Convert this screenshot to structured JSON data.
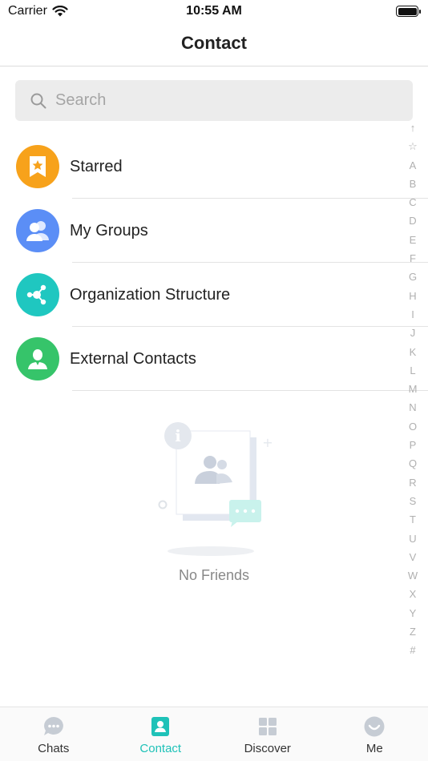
{
  "status_bar": {
    "carrier": "Carrier",
    "time": "10:55 AM"
  },
  "nav": {
    "title": "Contact"
  },
  "search": {
    "placeholder": "Search"
  },
  "list": [
    {
      "label": "Starred",
      "icon": "starred-icon",
      "color": "#f7a21b"
    },
    {
      "label": "My Groups",
      "icon": "groups-icon",
      "color": "#5b8ef6"
    },
    {
      "label": "Organization Structure",
      "icon": "organization-icon",
      "color": "#1fc7c0"
    },
    {
      "label": "External Contacts",
      "icon": "external-contacts-icon",
      "color": "#36c46a"
    }
  ],
  "empty_state": {
    "text": "No Friends"
  },
  "index_bar": [
    "↑",
    "☆",
    "A",
    "B",
    "C",
    "D",
    "E",
    "F",
    "G",
    "H",
    "I",
    "J",
    "K",
    "L",
    "M",
    "N",
    "O",
    "P",
    "Q",
    "R",
    "S",
    "T",
    "U",
    "V",
    "W",
    "X",
    "Y",
    "Z",
    "#"
  ],
  "tabs": [
    {
      "label": "Chats",
      "icon": "chats-icon",
      "active": false
    },
    {
      "label": "Contact",
      "icon": "contact-icon",
      "active": true
    },
    {
      "label": "Discover",
      "icon": "discover-icon",
      "active": false
    },
    {
      "label": "Me",
      "icon": "me-icon",
      "active": false
    }
  ],
  "colors": {
    "accent": "#1fc2b8",
    "tab_inactive_icon": "#c6ccd4"
  }
}
